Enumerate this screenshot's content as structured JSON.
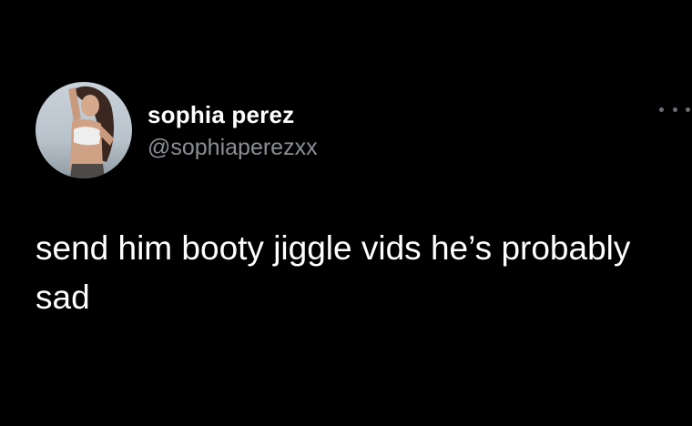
{
  "tweet": {
    "author": {
      "display_name": "sophia perez",
      "handle": "@sophiaperezxx",
      "avatar_icon": "profile-photo"
    },
    "more_icon": "more-options-icon",
    "text": "send him booty jiggle vids he’s probably sad"
  },
  "colors": {
    "background": "#000000",
    "primary_text": "#ffffff",
    "secondary_text": "#8b8f94"
  }
}
